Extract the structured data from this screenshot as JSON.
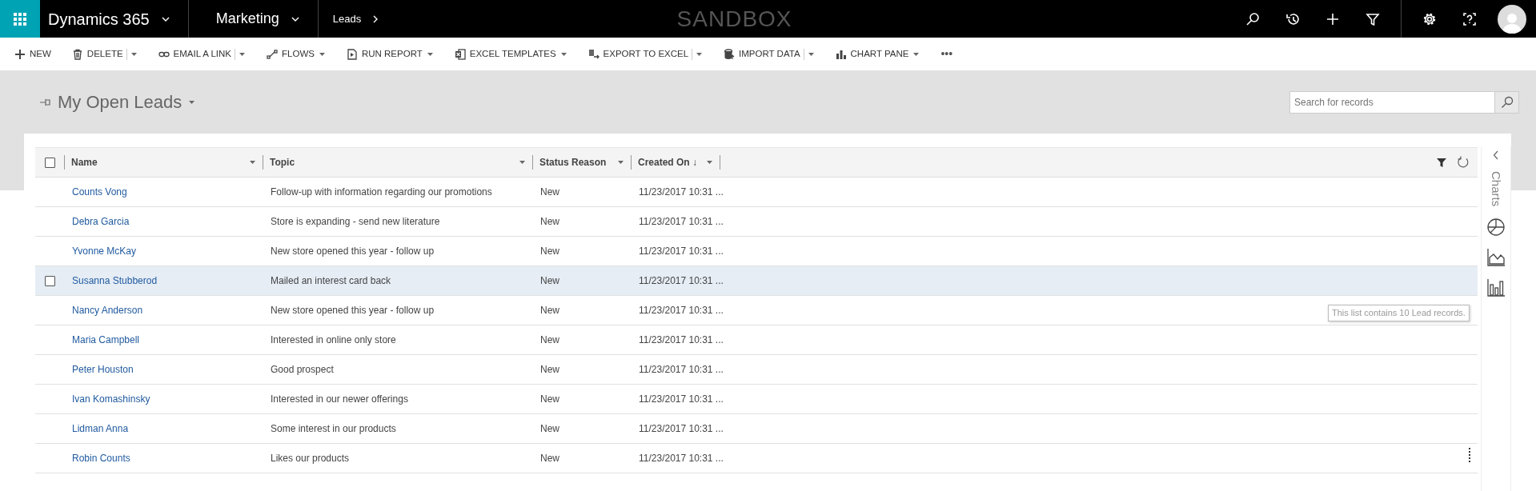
{
  "top_bar": {
    "app_name": "Dynamics 365",
    "area": "Marketing",
    "entity": "Leads",
    "environment_label": "SANDBOX"
  },
  "command_bar": {
    "commands": [
      {
        "label": "NEW",
        "kind": "plain"
      },
      {
        "label": "DELETE",
        "kind": "split"
      },
      {
        "label": "EMAIL A LINK",
        "kind": "split"
      },
      {
        "label": "FLOWS",
        "kind": "dropdown"
      },
      {
        "label": "RUN REPORT",
        "kind": "dropdown"
      },
      {
        "label": "EXCEL TEMPLATES",
        "kind": "dropdown"
      },
      {
        "label": "EXPORT TO EXCEL",
        "kind": "split"
      },
      {
        "label": "IMPORT DATA",
        "kind": "split"
      },
      {
        "label": "CHART PANE",
        "kind": "dropdown"
      }
    ],
    "more": "•••"
  },
  "view": {
    "title": "My Open Leads",
    "search": {
      "placeholder": "Search for records"
    }
  },
  "grid": {
    "select_all_checked": false,
    "columns": [
      {
        "label": "Name"
      },
      {
        "label": "Topic"
      },
      {
        "label": "Status Reason"
      },
      {
        "label": "Created On",
        "sort_indicator": "↓"
      }
    ],
    "rows": [
      {
        "name": "Counts Vong",
        "topic": "Follow-up with information regarding our promotions",
        "status_reason": "New",
        "created_on": "11/23/2017 10:31 ...",
        "hovered": false
      },
      {
        "name": "Debra Garcia",
        "topic": "Store is expanding - send new literature",
        "status_reason": "New",
        "created_on": "11/23/2017 10:31 ...",
        "hovered": false
      },
      {
        "name": "Yvonne McKay",
        "topic": "New store opened this year - follow up",
        "status_reason": "New",
        "created_on": "11/23/2017 10:31 ...",
        "hovered": false
      },
      {
        "name": "Susanna Stubberod",
        "topic": "Mailed an interest card back",
        "status_reason": "New",
        "created_on": "11/23/2017 10:31 ...",
        "hovered": true
      },
      {
        "name": "Nancy Anderson",
        "topic": "New store opened this year - follow up",
        "status_reason": "New",
        "created_on": "11/23/2017 10:31 ...",
        "hovered": false
      },
      {
        "name": "Maria Campbell",
        "topic": "Interested in online only store",
        "status_reason": "New",
        "created_on": "11/23/2017 10:31 ...",
        "hovered": false
      },
      {
        "name": "Peter Houston",
        "topic": "Good prospect",
        "status_reason": "New",
        "created_on": "11/23/2017 10:31 ...",
        "hovered": false
      },
      {
        "name": "Ivan Komashinsky",
        "topic": "Interested in our newer offerings",
        "status_reason": "New",
        "created_on": "11/23/2017 10:31 ...",
        "hovered": false
      },
      {
        "name": "Lidman Anna",
        "topic": "Some interest in our products",
        "status_reason": "New",
        "created_on": "11/23/2017 10:31 ...",
        "hovered": false
      },
      {
        "name": "Robin Counts",
        "topic": "Likes our products",
        "status_reason": "New",
        "created_on": "11/23/2017 10:31 ...",
        "hovered": false
      }
    ]
  },
  "chart_pane": {
    "label": "Charts"
  },
  "tooltip": "This list contains 10 Lead records."
}
